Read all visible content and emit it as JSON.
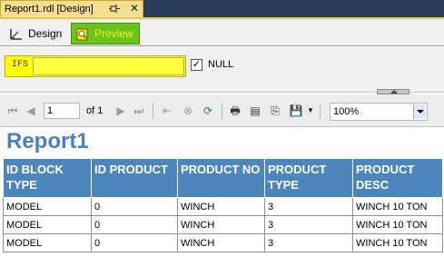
{
  "document_tab": {
    "title": "Report1.rdl [Design]",
    "pin_icon": "pin-icon",
    "close_icon": "close-icon"
  },
  "mode_tabs": [
    {
      "label": "Design",
      "icon": "design-icon",
      "active": false
    },
    {
      "label": "Preview",
      "icon": "preview-icon",
      "active": true
    }
  ],
  "parameters": {
    "label": "IFS",
    "value": "",
    "null_label": "NULL",
    "null_checked": true
  },
  "toolbar": {
    "page_input": "1",
    "page_of": "of 1",
    "zoom": "100%"
  },
  "report": {
    "title": "Report1",
    "columns": [
      "ID BLOCK TYPE",
      "ID PRODUCT",
      "PRODUCT NO",
      "PRODUCT TYPE",
      "PRODUCT DESC"
    ],
    "rows": [
      [
        "MODEL",
        "0",
        "WINCH",
        "3",
        "WINCH 10 TON"
      ],
      [
        "MODEL",
        "0",
        "WINCH",
        "3",
        "WINCH 10 TON"
      ],
      [
        "MODEL",
        "0",
        "WINCH",
        "3",
        "WINCH 10 TON"
      ]
    ]
  },
  "colors": {
    "accent_header": "#4d85bd",
    "title_blue": "#4a7fbb",
    "highlight_yellow": "#ffff00",
    "preview_green": "#6cc418"
  }
}
